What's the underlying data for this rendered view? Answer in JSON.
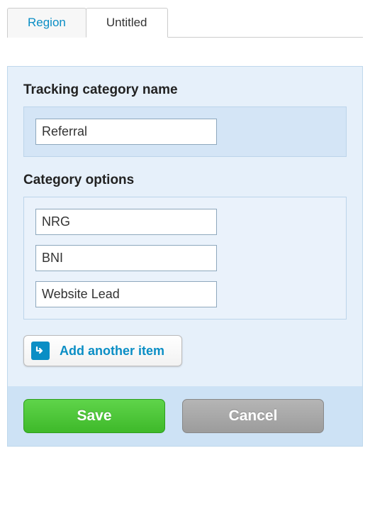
{
  "tabs": [
    {
      "label": "Region",
      "active": false
    },
    {
      "label": "Untitled",
      "active": true
    }
  ],
  "form": {
    "category_name_label": "Tracking category name",
    "category_name_value": "Referral",
    "options_label": "Category options",
    "options": [
      "NRG",
      "BNI",
      "Website Lead"
    ],
    "add_item_label": "Add another item"
  },
  "actions": {
    "save_label": "Save",
    "cancel_label": "Cancel"
  }
}
